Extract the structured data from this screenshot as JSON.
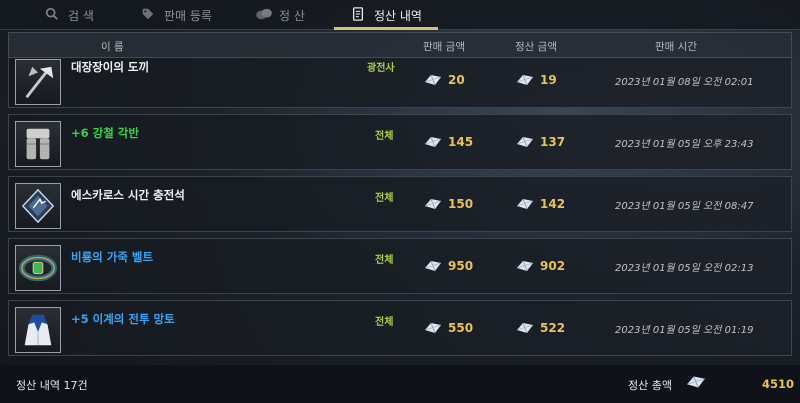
{
  "tabs": [
    {
      "label": "검 색",
      "icon": "search-icon",
      "active": false
    },
    {
      "label": "판매 등록",
      "icon": "tag-icon",
      "active": false
    },
    {
      "label": "정 산",
      "icon": "coins-icon",
      "active": false
    },
    {
      "label": "정산 내역",
      "icon": "receipt-icon",
      "active": true
    }
  ],
  "table": {
    "headers": {
      "name": "이 름",
      "sale_amount": "판매 금액",
      "settle_amount": "정산 금액",
      "sale_time": "판매 시간"
    },
    "rows": [
      {
        "name": "대장장이의 도끼",
        "name_color": "white",
        "class": "광전사",
        "sale": "20",
        "settle": "19",
        "time": "2023년 01월 08일 오전 02:01",
        "icon": "axe-icon"
      },
      {
        "name": "+6 강철 각반",
        "name_color": "green",
        "class": "전체",
        "sale": "145",
        "settle": "137",
        "time": "2023년 01월 05일 오후 23:43",
        "icon": "greaves-icon"
      },
      {
        "name": "에스카로스 시간 충전석",
        "name_color": "white",
        "class": "전체",
        "sale": "150",
        "settle": "142",
        "time": "2023년 01월 05일 오전 08:47",
        "icon": "charge-stone-icon"
      },
      {
        "name": "비룡의 가죽 벨트",
        "name_color": "blue",
        "class": "전체",
        "sale": "950",
        "settle": "902",
        "time": "2023년 01월 05일 오전 02:13",
        "icon": "belt-icon"
      },
      {
        "name": "+5 이계의 전투 망토",
        "name_color": "blue",
        "class": "전체",
        "sale": "550",
        "settle": "522",
        "time": "2023년 01월 05일 오전 01:19",
        "icon": "cloak-icon"
      }
    ]
  },
  "footer": {
    "count_label": "정산 내역 17건",
    "total_label": "정산 총액",
    "total_value": "4510"
  },
  "colors": {
    "accent": "#d9c36a",
    "currency": "#e8c458",
    "green_name": "#38d34a",
    "blue_name": "#39a4f5",
    "class_tag": "#a8d24a"
  }
}
